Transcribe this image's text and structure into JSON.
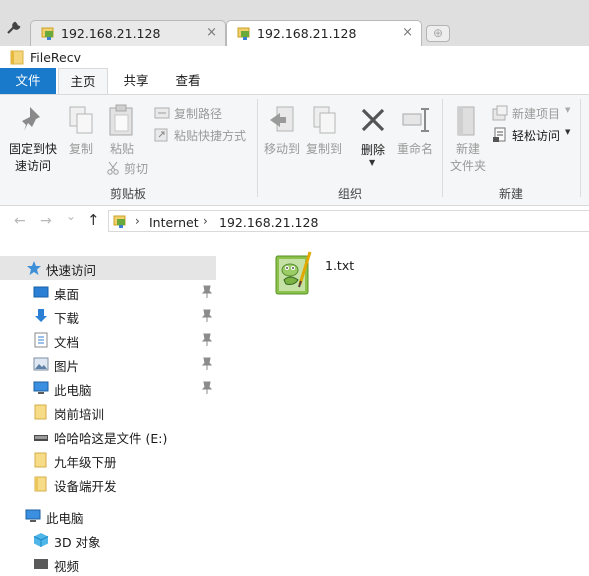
{
  "browser": {
    "tabs": [
      {
        "title": "192.168.21.128",
        "close": "×"
      },
      {
        "title": "192.168.21.128",
        "close": "×"
      }
    ],
    "new_tab": "⊕"
  },
  "window": {
    "title": "FileRecv"
  },
  "ribbon": {
    "tabs": [
      "文件",
      "主页",
      "共享",
      "查看"
    ],
    "clipboard": {
      "pin_l1": "固定到快",
      "pin_l2": "速访问",
      "copy": "复制",
      "paste": "粘贴",
      "copy_path": "复制路径",
      "paste_shortcut": "粘贴快捷方式",
      "cut": "剪切",
      "label": "剪贴板"
    },
    "organize": {
      "move_to": "移动到",
      "copy_to": "复制到",
      "delete": "删除",
      "rename": "重命名",
      "label": "组织"
    },
    "new": {
      "new_folder_l1": "新建",
      "new_folder_l2": "文件夹",
      "new_item": "新建项目",
      "easy_access": "轻松访问",
      "label": "新建"
    }
  },
  "address": {
    "back": "←",
    "forward": "→",
    "history": "⌄",
    "up": "↑",
    "crumbs": [
      "Internet",
      "192.168.21.128"
    ]
  },
  "nav": {
    "quick_access": "快速访问",
    "items": [
      {
        "label": "桌面",
        "icon": "desktop-icon",
        "pinned": true
      },
      {
        "label": "下载",
        "icon": "download-icon",
        "pinned": true
      },
      {
        "label": "文档",
        "icon": "document-icon",
        "pinned": true
      },
      {
        "label": "图片",
        "icon": "picture-icon",
        "pinned": true
      },
      {
        "label": "此电脑",
        "icon": "computer-icon",
        "pinned": true
      },
      {
        "label": "岗前培训",
        "icon": "folder-icon",
        "pinned": false
      },
      {
        "label": "哈哈哈这是文件 (E:)",
        "icon": "drive-icon",
        "pinned": false
      },
      {
        "label": "九年级下册",
        "icon": "folder-icon",
        "pinned": false
      },
      {
        "label": "设备端开发",
        "icon": "folder-icon",
        "pinned": false
      }
    ],
    "this_pc": "此电脑",
    "objects_3d": "3D 对象",
    "videos": "视频"
  },
  "files": [
    {
      "name": "1.txt",
      "icon": "notepad-plus-plus-file-icon"
    }
  ],
  "colors": {
    "accent": "#1979ca",
    "selection": "#e5e5e5",
    "ribbon_bg": "#f5f6f7"
  }
}
